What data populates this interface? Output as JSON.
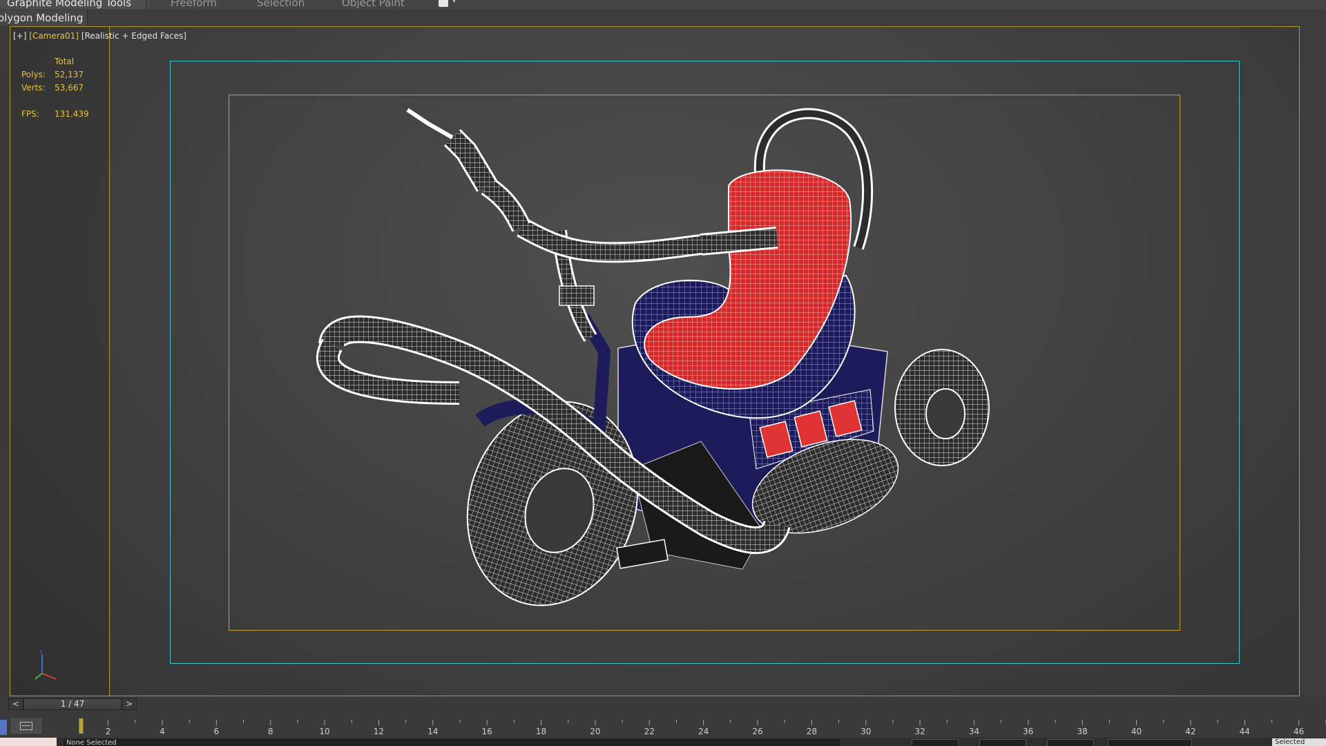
{
  "ribbon": {
    "tabs": [
      {
        "label": "Graphite Modeling Tools",
        "active": true
      },
      {
        "label": "Freeform",
        "active": false
      },
      {
        "label": "Selection",
        "active": false
      },
      {
        "label": "Object Paint",
        "active": false
      }
    ],
    "options_icon": "ribbon-options-icon"
  },
  "panel": {
    "label": "olygon Modeling"
  },
  "viewport": {
    "label_plus": "[+]",
    "label_camera": "[Camera01]",
    "label_shading": "[Realistic + Edged Faces]",
    "stats": {
      "total_label": "Total",
      "polys_label": "Polys:",
      "polys_value": "52,137",
      "verts_label": "Verts:",
      "verts_value": "53,667",
      "fps_label": "FPS:",
      "fps_value": "131.439"
    },
    "frame_colors": {
      "safe_frame_outer": "#37c6d0",
      "safe_frame_inner": "#c7a12d",
      "viewport_border": "#b59a2a"
    },
    "model_colors": {
      "seat": "#d42a2a",
      "body": "#1c1c5a",
      "wire": "#ffffff"
    },
    "axis_icon": "axis-tripod-icon"
  },
  "time_slider": {
    "prev": "<",
    "next": ">",
    "frame_text": "1 / 47",
    "current_frame": 1,
    "total_frames": 47
  },
  "timeline": {
    "ticks": [
      "2",
      "4",
      "6",
      "8",
      "10",
      "12",
      "14",
      "16",
      "18",
      "20",
      "22",
      "24",
      "26",
      "28",
      "30",
      "32",
      "34",
      "36",
      "38",
      "40",
      "42",
      "44",
      "46"
    ]
  },
  "status_bar": {
    "prompt": "None Selected",
    "selected_label": "Selected"
  }
}
